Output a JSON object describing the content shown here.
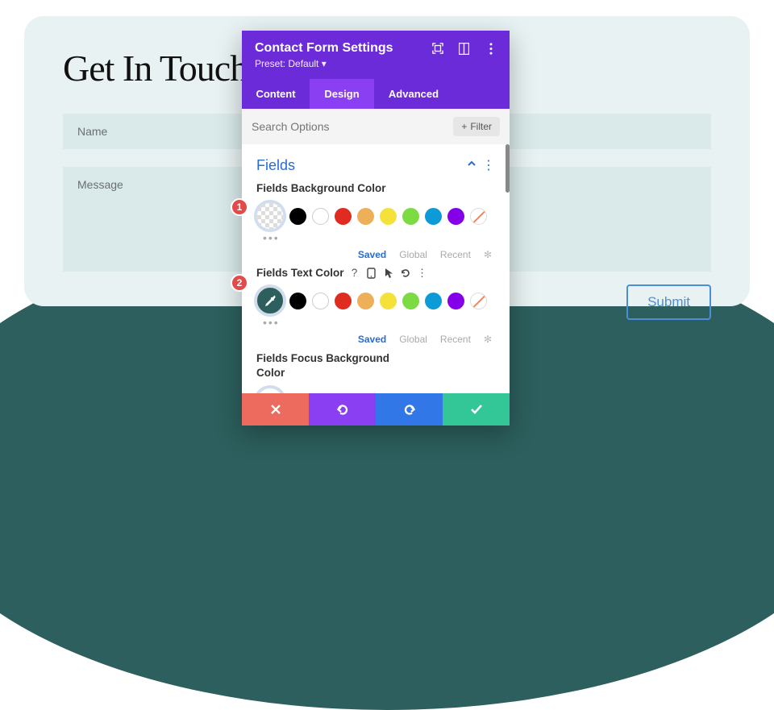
{
  "page": {
    "title": "Get In Touch",
    "name_placeholder": "Name",
    "message_placeholder": "Message",
    "submit_label": "Submit"
  },
  "panel": {
    "title": "Contact Form Settings",
    "preset_label": "Preset: Default",
    "tabs": [
      {
        "label": "Content",
        "active": false
      },
      {
        "label": "Design",
        "active": true
      },
      {
        "label": "Advanced",
        "active": false
      }
    ],
    "search_placeholder": "Search Options",
    "filter_label": "Filter",
    "section_title": "Fields",
    "options": [
      {
        "label": "Fields Background Color",
        "lead": "transparent",
        "tools": false
      },
      {
        "label": "Fields Text Color",
        "lead": "picker-dark",
        "tools": true
      },
      {
        "label": "Fields Focus Background Color",
        "lead": "picker-light",
        "tools": false
      }
    ],
    "footer_links": {
      "saved": "Saved",
      "global": "Global",
      "recent": "Recent"
    },
    "palette": [
      "#000000",
      "#ffffff",
      "#e02b20",
      "#edb059",
      "#f4e23a",
      "#7cdb42",
      "#0c9bd6",
      "#8300e9",
      "slash"
    ]
  },
  "badges": {
    "b1": "1",
    "b2": "2"
  },
  "colors": {
    "accent": "#6c2bd9"
  }
}
